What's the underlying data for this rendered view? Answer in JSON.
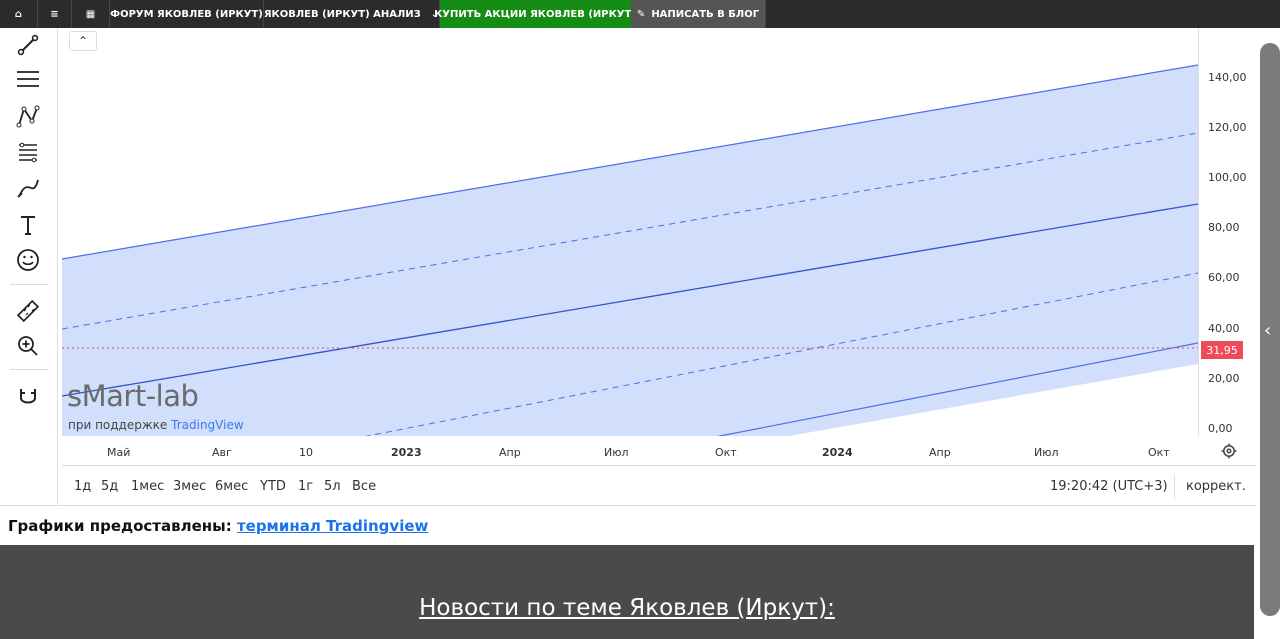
{
  "topbar": {
    "forum": "ФОРУМ ЯКОВЛЕВ (ИРКУТ)",
    "analysis": "ЯКОВЛЕВ (ИРКУТ) АНАЛИЗ",
    "buy": "КУПИТЬ АКЦИИ ЯКОВЛЕВ (ИРКУТ)",
    "blog": "НАПИСАТЬ В БЛОГ",
    "home_icon": "home-icon",
    "menu_icon": "menu-icon",
    "grid_icon": "grid-icon",
    "edit_icon": "edit-icon",
    "chevron_icon": "chevron-down-icon"
  },
  "toolbar": {
    "tools": [
      {
        "name": "trend-line-tool",
        "icon": "line-icon"
      },
      {
        "name": "parallel-channel-tool",
        "icon": "parallel-channel-icon"
      },
      {
        "name": "pattern-tool",
        "icon": "pattern-icon"
      },
      {
        "name": "fibonacci-tool",
        "icon": "fibonacci-icon"
      },
      {
        "name": "brush-tool",
        "icon": "brush-icon"
      },
      {
        "name": "text-tool",
        "icon": "text-icon"
      },
      {
        "name": "emoji-tool",
        "icon": "smile-icon"
      },
      {
        "name": "ruler-tool",
        "icon": "ruler-icon"
      },
      {
        "name": "zoom-tool",
        "icon": "zoom-icon"
      },
      {
        "name": "magnet-tool",
        "icon": "magnet-icon"
      }
    ]
  },
  "price_scale": {
    "labels": [
      "140,00",
      "120,00",
      "100,00",
      "80,00",
      "60,00",
      "40,00",
      "20,00",
      "0,00"
    ],
    "current": "31,95"
  },
  "time_scale": {
    "labels": [
      "Май",
      "Авг",
      "10",
      "2023",
      "Апр",
      "Июл",
      "Окт",
      "2024",
      "Апр",
      "Июл",
      "Окт"
    ]
  },
  "watermark": {
    "brand": "sMart-lab",
    "support_prefix": "при поддержке",
    "support_brand": "TradingView"
  },
  "range_buttons": [
    "1д",
    "5д",
    "1мес",
    "3мес",
    "6мес",
    "YTD",
    "1г",
    "5л",
    "Все"
  ],
  "clock": "19:20:42 (UTC+3)",
  "correction": "коррект.",
  "source": {
    "prefix": "Графики предоставлены:",
    "link": "терминал Tradingview"
  },
  "news": {
    "title": "Новости по теме Яковлев (Иркут):"
  },
  "colors": {
    "channel_fill": "#cfdcfc",
    "channel_line": "#4f6ee8",
    "candle_up": "#26a69a",
    "candle_down": "#ef5350",
    "current_price": "#ef4a5a",
    "buy_bg": "#158c14"
  }
}
